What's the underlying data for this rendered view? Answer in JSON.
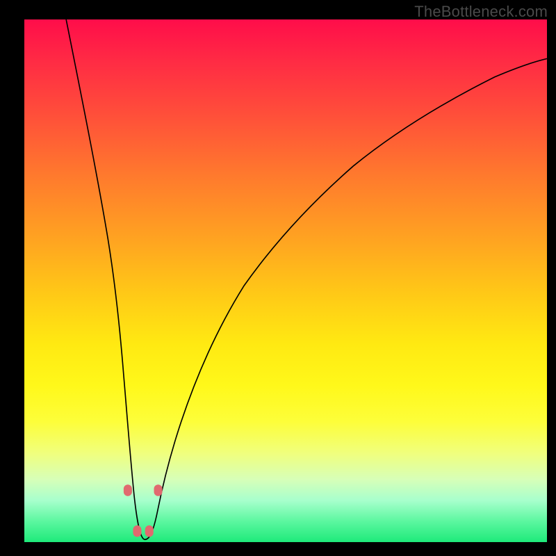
{
  "watermark": "TheBottleneck.com",
  "chart_data": {
    "type": "line",
    "title": "",
    "xlabel": "",
    "ylabel": "",
    "xlim": [
      0,
      100
    ],
    "ylim": [
      0,
      100
    ],
    "grid": false,
    "legend": false,
    "curve": {
      "name": "bottleneck-curve",
      "color": "#000000",
      "x": [
        8,
        10,
        12,
        14,
        16,
        18,
        19,
        20,
        21,
        22,
        23,
        24,
        25,
        26,
        28,
        30,
        32,
        34,
        36,
        40,
        45,
        50,
        55,
        60,
        65,
        70,
        75,
        80,
        85,
        90,
        95,
        100
      ],
      "y": [
        100,
        92,
        82,
        71,
        58,
        42,
        32,
        20,
        10,
        3,
        0.5,
        0.5,
        2,
        5,
        12,
        20,
        28,
        35,
        41,
        50,
        59,
        66,
        71,
        75.5,
        79,
        82,
        84.5,
        86.5,
        88,
        89.3,
        90.3,
        91
      ]
    },
    "markers": {
      "name": "datapoints",
      "color": "#e06a6f",
      "shape": "rounded-rect",
      "x": [
        19.7,
        21.5,
        23.8,
        25.5
      ],
      "y": [
        9.8,
        1.8,
        1.8,
        9.8
      ]
    },
    "background_gradient": {
      "top": "#ff0d4a",
      "mid": "#ffe912",
      "bottom": "#1eea7a"
    }
  }
}
